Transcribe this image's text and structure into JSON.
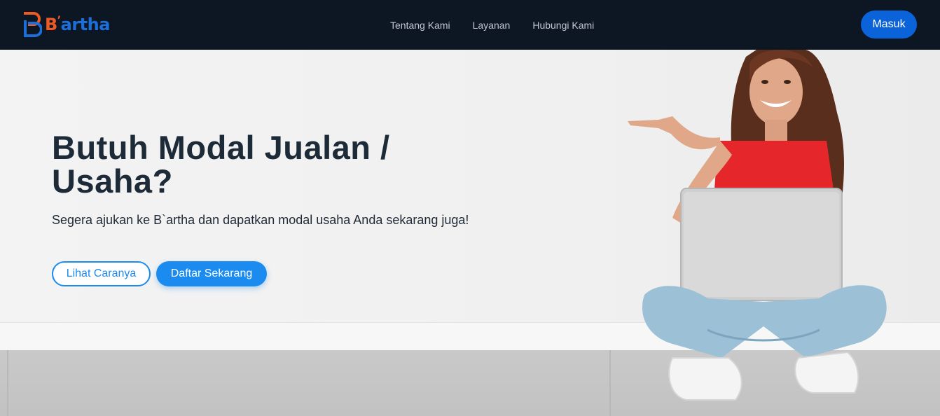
{
  "brand": {
    "name_b": "B",
    "name_rest": "artha",
    "accent": "#ef5a24",
    "primary": "#1c6fd8"
  },
  "nav": {
    "links": [
      "Tentang Kami",
      "Layanan",
      "Hubungi Kami"
    ],
    "login_label": "Masuk"
  },
  "hero": {
    "title": "Butuh Modal Jualan / Usaha?",
    "subtitle": "Segera ajukan ke B`artha dan dapatkan modal usaha Anda sekarang juga!",
    "btn_secondary": "Lihat Caranya",
    "btn_primary": "Daftar Sekarang"
  },
  "colors": {
    "navbar_bg": "#0d1623",
    "button_blue": "#1b8bf0",
    "login_blue": "#0b63d9"
  }
}
